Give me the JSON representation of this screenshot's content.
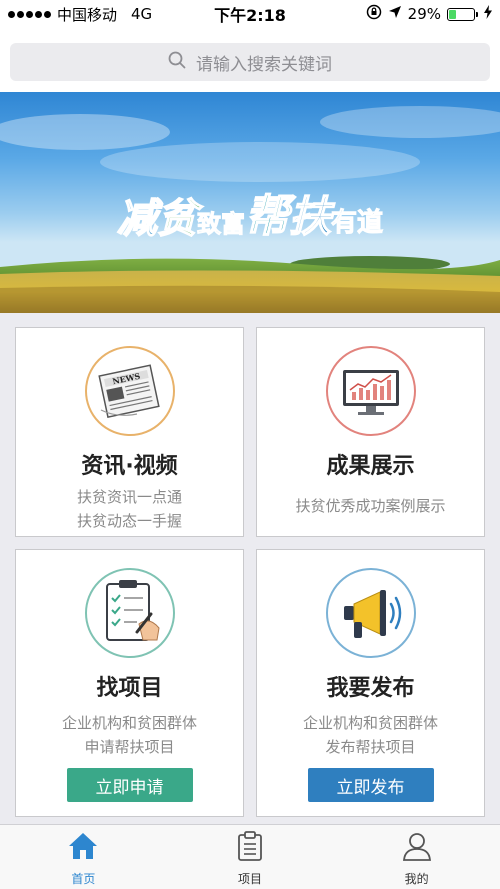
{
  "status_bar": {
    "carrier": "中国移动",
    "network": "4G",
    "time": "下午2:18",
    "battery_percent": "29%",
    "battery_level": 0.29,
    "battery_color": "#4cd964"
  },
  "search": {
    "placeholder": "请输入搜索关键词",
    "icon": "search-icon"
  },
  "banner": {
    "slogan_parts": [
      "减",
      "贫",
      "致富",
      "帮",
      "扶",
      "有道"
    ]
  },
  "cards": [
    {
      "title": "资讯·视频",
      "subtitle_lines": [
        "扶贫资讯一点通",
        "扶贫动态一手握"
      ],
      "icon": "newspaper-icon",
      "ring_color": "#e8b26a"
    },
    {
      "title": "成果展示",
      "subtitle_lines": [
        "扶贫优秀成功案例展示"
      ],
      "icon": "chart-monitor-icon",
      "ring_color": "#e2837d"
    },
    {
      "title": "找项目",
      "subtitle_lines": [
        "企业机构和贫困群体",
        "申请帮扶项目"
      ],
      "button": "立即申请",
      "button_color": "#3aa889",
      "icon": "clipboard-sign-icon",
      "ring_color": "#7fc3b3"
    },
    {
      "title": "我要发布",
      "subtitle_lines": [
        "企业机构和贫困群体",
        "发布帮扶项目"
      ],
      "button": "立即发布",
      "button_color": "#2f7fbf",
      "icon": "megaphone-icon",
      "ring_color": "#7bb2d6"
    }
  ],
  "tabs": [
    {
      "label": "首页",
      "icon": "home-icon",
      "active": true
    },
    {
      "label": "项目",
      "icon": "clipboard-icon",
      "active": false
    },
    {
      "label": "我的",
      "icon": "user-icon",
      "active": false
    }
  ],
  "colors": {
    "accent": "#2d86cf",
    "page_background": "#ebebf0"
  }
}
